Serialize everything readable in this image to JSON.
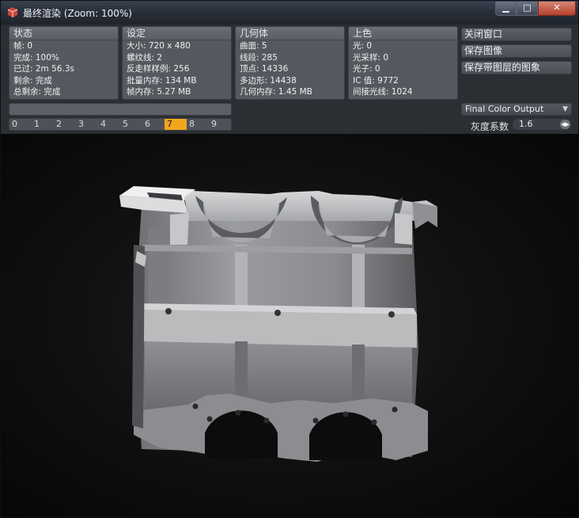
{
  "window": {
    "title": "最终渲染 (Zoom: 100%)"
  },
  "panels": [
    {
      "title": "状态",
      "lines": [
        "帧: 0",
        "完成: 100%",
        "已过: 2m 56.3s",
        "剩余: 完成",
        "总剩余: 完成"
      ]
    },
    {
      "title": "设定",
      "lines": [
        "大小: 720 x 480",
        "螺纹线: 2",
        "反走样样例: 256",
        "批量内存: 134 MB",
        "帧内存: 5.27 MB"
      ]
    },
    {
      "title": "几何体",
      "lines": [
        "曲面: 5",
        "线段: 285",
        "顶点: 14336",
        "多边形: 14438",
        "几何内存: 1.45 MB"
      ]
    },
    {
      "title": "上色",
      "lines": [
        "光: 0",
        "光采样: 0",
        "光子: 0",
        "IC 值: 9772",
        "间接光线: 1024"
      ]
    }
  ],
  "actions": {
    "close": "关闭窗口",
    "save_image": "保存图像",
    "save_layered": "保存带图层的图象"
  },
  "progress": {
    "value": 1.0
  },
  "buffers": {
    "items": [
      "0",
      "1",
      "2",
      "3",
      "4",
      "5",
      "6",
      "7",
      "8",
      "9"
    ],
    "active": "7"
  },
  "output_select": {
    "value": "Final Color Output"
  },
  "gamma": {
    "label": "灰度系数",
    "value": "1.6"
  },
  "icons": {
    "app": "render-icon",
    "minimize": "minimize-icon",
    "maximize": "maximize-icon",
    "close": "close-icon",
    "dropdown": "chevron-down-icon",
    "spinner": "spinner-arrows-icon"
  },
  "colors": {
    "active_buffer": "#f2a51d",
    "close_button": "#c45a47"
  }
}
